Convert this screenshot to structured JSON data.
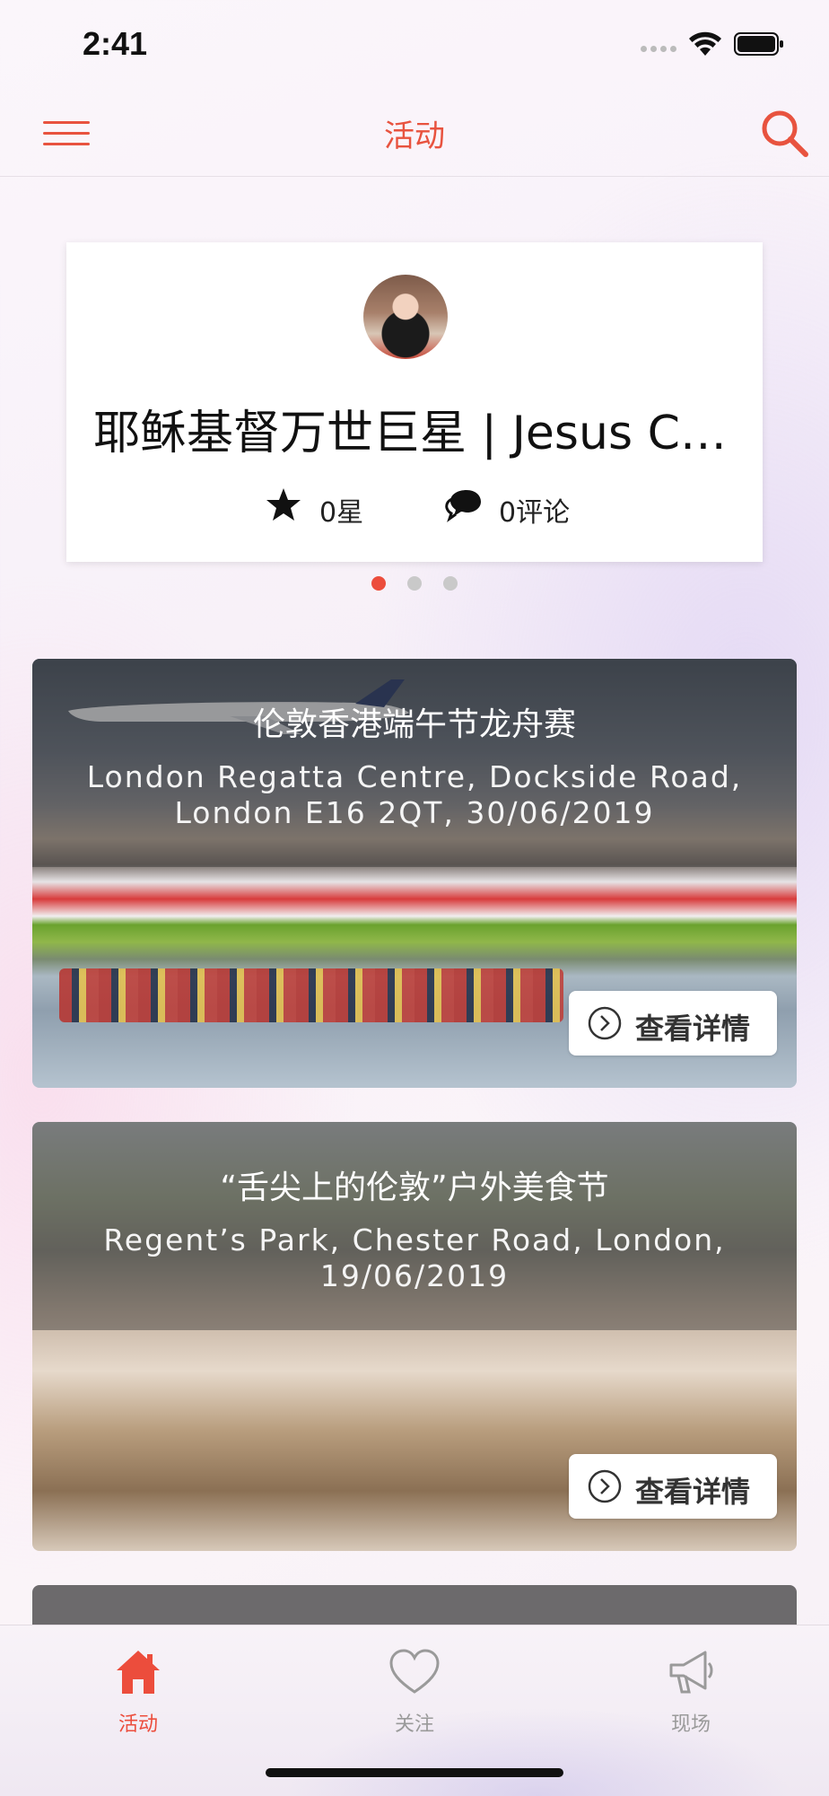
{
  "status_bar": {
    "time": "2:41"
  },
  "nav": {
    "title": "活动",
    "menu_icon": "hamburger-menu-icon",
    "search_icon": "search-icon"
  },
  "featured": {
    "title": "耶稣基督万世巨星 | Jesus Christ Superstar",
    "stars": "0星",
    "comments": "0评论",
    "pages": 3,
    "active_page": 1
  },
  "events": [
    {
      "title": "伦敦香港端午节龙舟赛",
      "subtitle": "London Regatta Centre, Dockside Road, London E16 2QT, 30/06/2019",
      "button": "查看详情"
    },
    {
      "title": "“舌尖上的伦敦”户外美食节",
      "subtitle": "Regent’s Park, Chester Road, London, 19/06/2019",
      "button": "查看详情"
    }
  ],
  "tabs": [
    {
      "label": "活动",
      "icon": "home-icon",
      "active": true
    },
    {
      "label": "关注",
      "icon": "heart-icon",
      "active": false
    },
    {
      "label": "现场",
      "icon": "megaphone-icon",
      "active": false
    }
  ],
  "colors": {
    "accent": "#ec4d3c",
    "inactive": "#9a9a9a"
  }
}
